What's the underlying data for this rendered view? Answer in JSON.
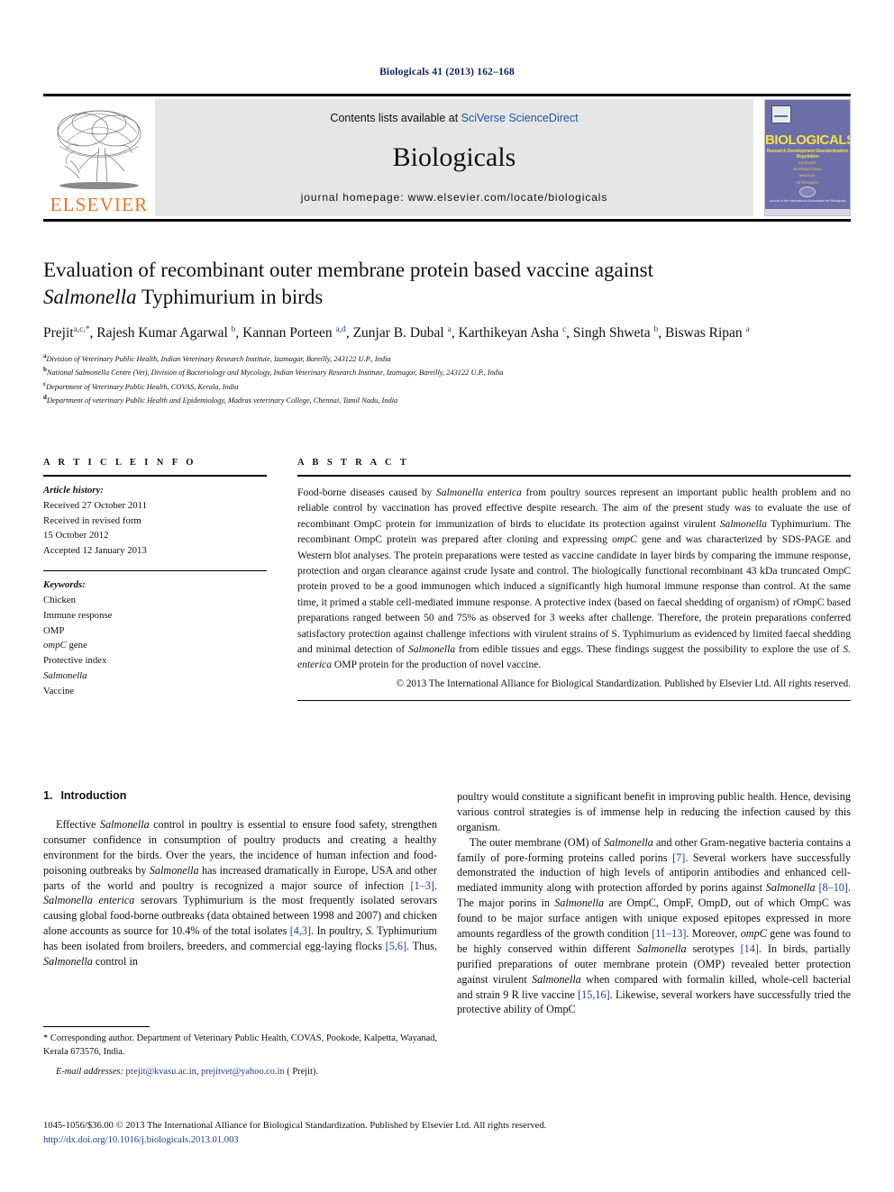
{
  "running_head": "Biologicals 41 (2013) 162–168",
  "header": {
    "contents_prefix": "Contents lists available at ",
    "sciencedirect": "SciVerse ScienceDirect",
    "journal_name": "Biologicals",
    "homepage": "journal homepage: www.elsevier.com/locate/biologicals",
    "publisher_logo_text": "ELSEVIER",
    "cover": {
      "title": "BIOLOGICALS",
      "subtitle": "Research Development Standardization Regulation",
      "lines": "ELSEVIER\nINTERNATIONAL\nMEDICAL\nVETERINARY",
      "footer": "Journal of the International Association for Biologicals"
    }
  },
  "article": {
    "title_line1": "Evaluation of recombinant outer membrane protein based vaccine against",
    "title_italic": "Salmonella",
    "title_line2_rest": " Typhimurium in birds",
    "authors_html": "Prejit<sup>a,c,</sup><sup>*</sup>, Rajesh Kumar Agarwal <sup>b</sup>, Kannan Porteen <sup>a,d</sup>, Zunjar B. Dubal <sup>a</sup>, Karthikeyan Asha <sup>c</sup>, Singh Shweta <sup>b</sup>, Biswas Ripan <sup>a</sup>",
    "affiliations": [
      {
        "marker": "a",
        "text": "Division of Veterinary Public Health, Indian Veterinary Research Institute, Izatnagar, Bareilly, 243122 U.P., India"
      },
      {
        "marker": "b",
        "text": "National Salmonella Centre (Vet), Division of Bacteriology and Mycology, Indian Veterinary Research Institute, Izatnagar, Bareilly, 243122 U.P., India"
      },
      {
        "marker": "c",
        "text": "Department of Veterinary Public Health, COVAS, Kerala, India"
      },
      {
        "marker": "d",
        "text": "Department of veterinary Public Health and Epidemiology, Madras veterinary College, Chennai, Tamil Nadu, India"
      }
    ]
  },
  "article_info": {
    "heading": "A R T I C L E   I N F O",
    "history_label": "Article history:",
    "history": [
      "Received 27 October 2011",
      "Received in revised form",
      "15 October 2012",
      "Accepted 12 January 2013"
    ],
    "keywords_label": "Keywords:",
    "keywords": [
      "Chicken",
      "Immune response",
      "OMP",
      "ompC gene",
      "Protective index",
      "Salmonella",
      "Vaccine"
    ]
  },
  "abstract": {
    "heading": "A B S T R A C T",
    "text_html": "Food-borne diseases caused by <i>Salmonella enterica</i> from poultry sources represent an important public health problem and no reliable control by vaccination has proved effective despite research. The aim of the present study was to evaluate the use of recombinant OmpC protein for immunization of birds to elucidate its protection against virulent <i>Salmonella</i> Typhimurium. The recombinant OmpC protein was prepared after cloning and expressing <i>ompC</i> gene and was characterized by SDS-PAGE and Western blot analyses. The protein preparations were tested as vaccine candidate in layer birds by comparing the immune response, protection and organ clearance against crude lysate and control. The biologically functional recombinant 43 kDa truncated OmpC protein proved to be a good immunogen which induced a significantly high humoral immune response than control. At the same time, it primed a stable cell-mediated immune response. A protective index (based on faecal shedding of organism) of rOmpC based preparations ranged between 50 and 75% as observed for 3 weeks after challenge. Therefore, the protein preparations conferred satisfactory protection against challenge infections with virulent strains of S. Typhimurium as evidenced by limited faecal shedding and minimal detection of <i>Salmonella</i> from edible tissues and eggs. These findings suggest the possibility to explore the use of <i>S. enterica</i> OMP protein for the production of novel vaccine.",
    "copyright": "© 2013 The International Alliance for Biological Standardization. Published by Elsevier Ltd. All rights reserved."
  },
  "introduction": {
    "number": "1.",
    "heading": "Introduction",
    "left_paragraphs_html": [
      "Effective <i>Salmonella</i> control in poultry is essential to ensure food safety, strengthen consumer confidence in consumption of poultry products and creating a healthy environment for the birds. Over the years, the incidence of human infection and food-poisoning outbreaks by <i>Salmonella</i> has increased dramatically in Europe, USA and other parts of the world and poultry is recognized a major source of infection <span class=\"ref\">[1–3]</span>. <i>Salmonella enterica</i> serovars Typhimurium is the most frequently isolated serovars causing global food-borne outbreaks (data obtained between 1998 and 2007) and chicken alone accounts as source for 10.4% of the total isolates <span class=\"ref\">[4,3]</span>. In poultry, <i>S.</i> Typhimurium has been isolated from broilers, breeders, and commercial egg-laying flocks <span class=\"ref\">[5,6]</span>. Thus, <i>Salmonella</i> control in"
    ],
    "right_paragraphs_html": [
      "poultry would constitute a significant benefit in improving public health. Hence, devising various control strategies is of immense help in reducing the infection caused by this organism.",
      "The outer membrane (OM) of <i>Salmonella</i> and other Gram-negative bacteria contains a family of pore-forming proteins called porins <span class=\"ref\">[7]</span>. Several workers have successfully demonstrated the induction of high levels of antiporin antibodies and enhanced cell-mediated immunity along with protection afforded by porins against <i>Salmonella</i> <span class=\"ref\">[8–10]</span>. The major porins in <i>Salmonella</i> are OmpC, OmpF, OmpD, out of which OmpC was found to be major surface antigen with unique exposed epitopes expressed in more amounts regardless of the growth condition <span class=\"ref\">[11–13]</span>. Moreover, <i>ompC</i> gene was found to be highly conserved within different <i>Salmonella</i> serotypes <span class=\"ref\">[14]</span>. In birds, partially purified preparations of outer membrane protein (OMP) revealed better protection against virulent <i>Salmonella</i> when compared with formalin killed, whole-cell bacterial and strain 9 R live vaccine <span class=\"ref\">[15,16]</span>. Likewise, several workers have successfully tried the protective ability of OmpC"
    ]
  },
  "footnotes": {
    "corresponding_html": "* Corresponding author. Department of Veterinary Public Health, COVAS, Pookode, Kalpetta, Wayanad, Kerala 673576, India.",
    "email_label": "E-mail addresses:",
    "email_1": "prejit@kvasu.ac.in",
    "email_2": "prejitvet@yahoo.co.in",
    "email_suffix": " ( Prejit)."
  },
  "issn_line_html": "1045-1056/$36.00 © 2013 The International Alliance for Biological Standardization. Published by Elsevier Ltd. All rights reserved.",
  "doi": "http://dx.doi.org/10.1016/j.biologicals.2013.01.003",
  "colors": {
    "link": "#1f3d8f",
    "running_head": "#151a63",
    "elsevier_orange": "#e87422",
    "band_gray": "#e6e6e6",
    "cover_purple": "#6c6ea8",
    "cover_yellow": "#f6e04a"
  }
}
